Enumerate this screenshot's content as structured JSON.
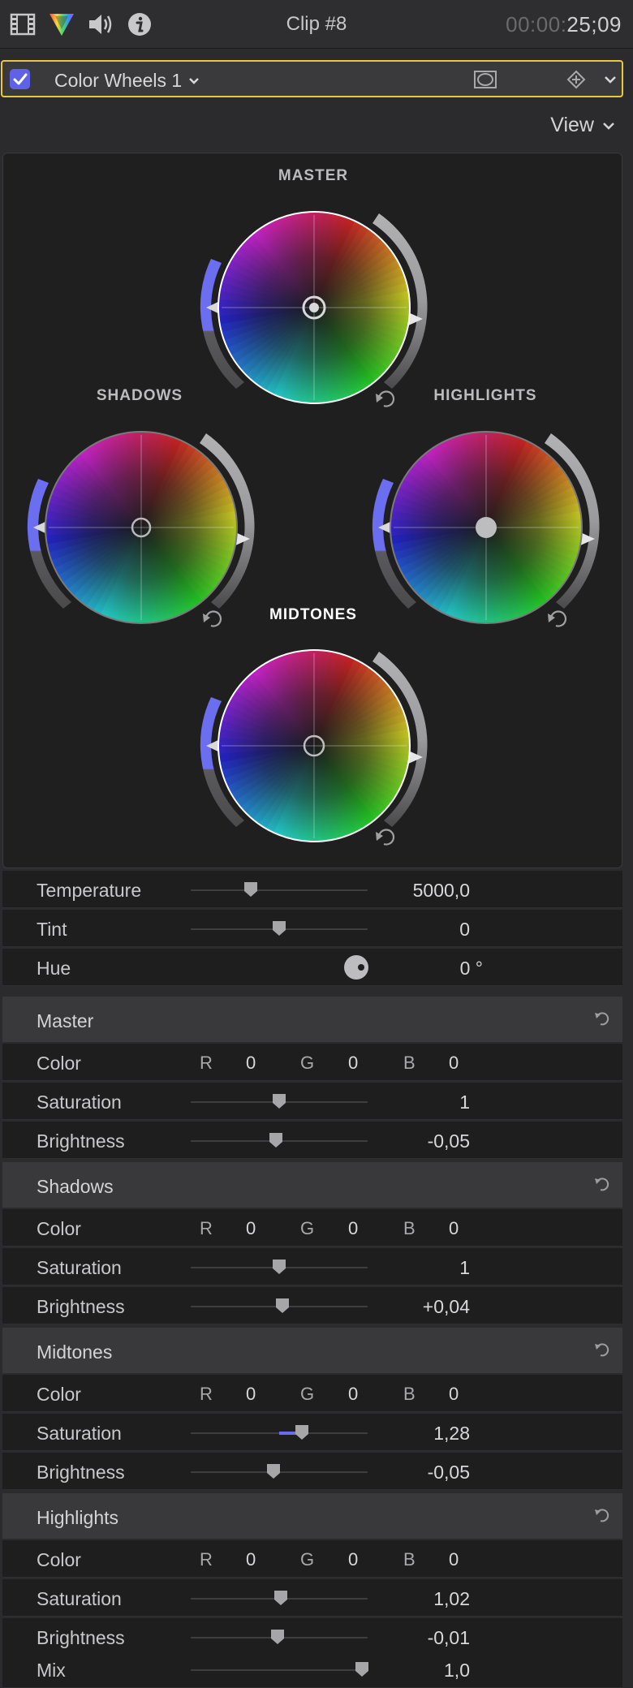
{
  "topbar": {
    "clip_title": "Clip #8",
    "timecode_dim": "00:00:",
    "timecode_bright": "25;09",
    "icons": [
      "film-icon",
      "color-prism-icon",
      "speaker-icon",
      "info-icon"
    ]
  },
  "effect": {
    "enabled": true,
    "name": "Color Wheels 1",
    "buttons": [
      "mask-icon",
      "keyframe-icon",
      "chevron-down-icon"
    ]
  },
  "view_label": "View",
  "wheels": {
    "master": "MASTER",
    "shadows": "SHADOWS",
    "highlights": "HIGHLIGHTS",
    "midtones": "MIDTONES"
  },
  "top_params": [
    {
      "label": "Temperature",
      "value": "5000,0",
      "slider": 0.34
    },
    {
      "label": "Tint",
      "value": "0",
      "slider": 0.5
    },
    {
      "label": "Hue",
      "value": "0 °"
    }
  ],
  "sections": [
    {
      "title": "Master",
      "color": {
        "r": "0",
        "g": "0",
        "b": "0"
      },
      "saturation": {
        "label": "Saturation",
        "value": "1",
        "slider": 0.5
      },
      "brightness": {
        "label": "Brightness",
        "value": "-0,05",
        "slider": 0.48
      }
    },
    {
      "title": "Shadows",
      "color": {
        "r": "0",
        "g": "0",
        "b": "0"
      },
      "saturation": {
        "label": "Saturation",
        "value": "1",
        "slider": 0.5
      },
      "brightness": {
        "label": "Brightness",
        "value": "+0,04",
        "slider": 0.52
      }
    },
    {
      "title": "Midtones",
      "color": {
        "r": "0",
        "g": "0",
        "b": "0"
      },
      "saturation": {
        "label": "Saturation",
        "value": "1,28",
        "slider": 0.63
      },
      "brightness": {
        "label": "Brightness",
        "value": "-0,05",
        "slider": 0.47
      }
    },
    {
      "title": "Highlights",
      "color": {
        "r": "0",
        "g": "0",
        "b": "0"
      },
      "saturation": {
        "label": "Saturation",
        "value": "1,02",
        "slider": 0.51
      },
      "brightness": {
        "label": "Brightness",
        "value": "-0,01",
        "slider": 0.49
      }
    }
  ],
  "color_label": "Color",
  "rgb_letters": {
    "r": "R",
    "g": "G",
    "b": "B"
  },
  "mix": {
    "label": "Mix",
    "value": "1,0",
    "slider": 0.97
  },
  "colors": {
    "accent": "#5f62e6",
    "selection": "#e8c93a"
  }
}
